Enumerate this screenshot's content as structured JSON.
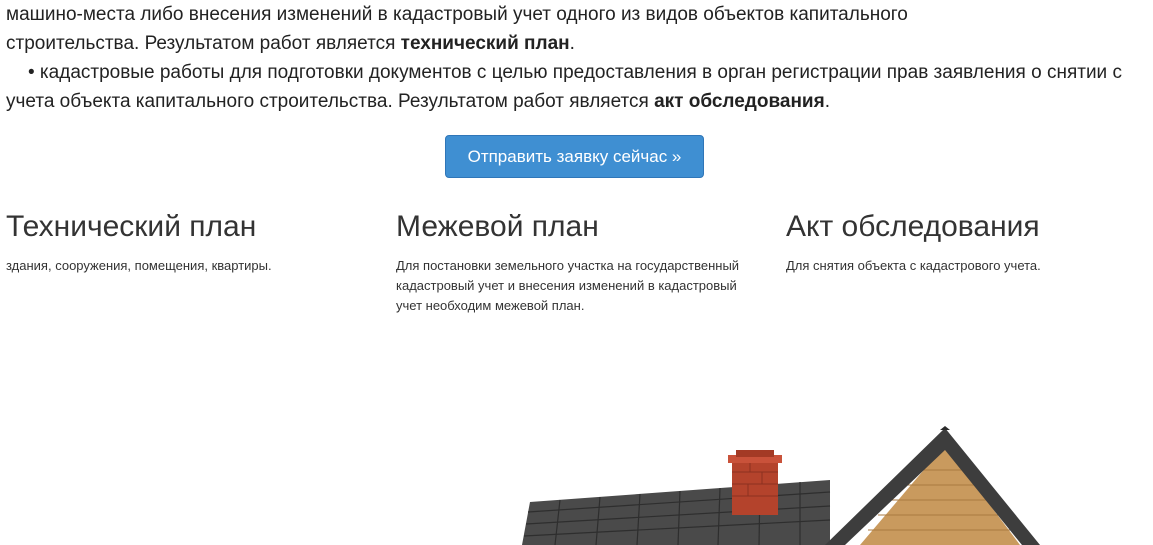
{
  "intro": {
    "line1": "машино-места либо внесения изменений в кадастровый учет одного из видов объектов капитального",
    "line2_pre": "строительства. Результатом работ является ",
    "line2_bold": "технический план",
    "line2_post": ".",
    "bullet_pre": "• кадастровые работы для подготовки документов с целью предоставления в орган регистрации прав заявления о снятии с учета объекта капитального строительства. Результатом работ является ",
    "bullet_bold": "акт обследования",
    "bullet_post": "."
  },
  "cta": {
    "label": "Отправить заявку сейчас »",
    "color": "#3f8fd2"
  },
  "services": [
    {
      "title": "Технический план",
      "text": "здания, сооружения, помещения, квартиры."
    },
    {
      "title": "Межевой план",
      "text": "Для постановки земельного участка на государственный кадастровый учет и внесения изменений в кадастровый учет необходим межевой план."
    },
    {
      "title": "Акт обследования",
      "text": "Для снятия объекта с кадастрового учета."
    }
  ],
  "house_image": {
    "icon": "house-icon"
  }
}
